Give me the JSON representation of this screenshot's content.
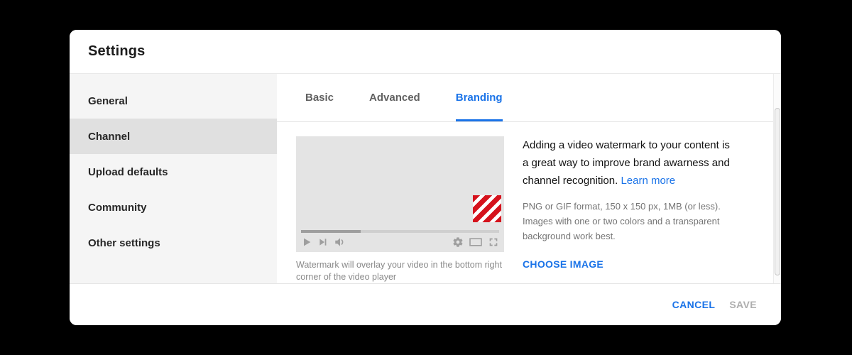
{
  "window": {
    "title": "Settings"
  },
  "sidebar": {
    "items": [
      {
        "label": "General"
      },
      {
        "label": "Channel"
      },
      {
        "label": "Upload defaults"
      },
      {
        "label": "Community"
      },
      {
        "label": "Other settings"
      }
    ],
    "selected": "Channel"
  },
  "tabs": {
    "items": [
      {
        "label": "Basic"
      },
      {
        "label": "Advanced"
      },
      {
        "label": "Branding"
      }
    ],
    "active": "Branding"
  },
  "branding_panel": {
    "player": {
      "caption": "Watermark will overlay your video in the bottom right corner of the video player",
      "progress_percent": 30,
      "icons": [
        "play-icon",
        "next-icon",
        "volume-icon",
        "settings-gear-icon",
        "theater-mode-icon",
        "fullscreen-icon"
      ]
    },
    "description": "Adding a video watermark to your content is a great way to improve brand awarness and channel recognition.",
    "learn_more_label": "Learn more",
    "format_hint": "PNG or GIF format, 150 x 150 px, 1MB (or less). Images with one or two colors and a transparent background work best.",
    "choose_image_label": "CHOOSE IMAGE"
  },
  "footer": {
    "cancel_label": "CANCEL",
    "save_label": "SAVE",
    "save_enabled": false
  },
  "colors": {
    "accent_blue": "#1a73e8",
    "watermark_red": "#d5121c",
    "sidebar_bg": "#f5f5f5",
    "selected_item_bg": "#e0e0e0",
    "player_bg": "#e4e4e4",
    "icon_gray": "#9e9e9e",
    "disabled_text": "#aeaeae",
    "background": "#000000"
  }
}
